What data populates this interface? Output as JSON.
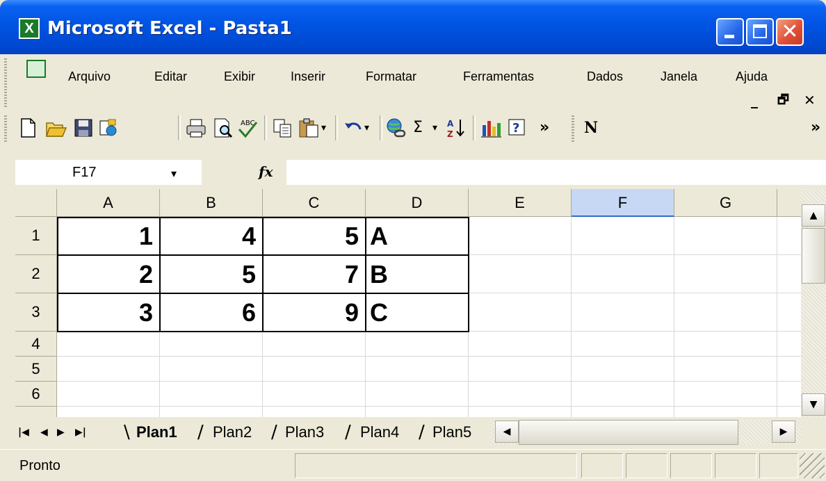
{
  "window": {
    "title": "Microsoft Excel - Pasta1",
    "app_icon_glyph": "X",
    "controls": {
      "minimize_icon": "minimize-icon",
      "maximize_icon": "maximize-icon",
      "close_glyph": "✕"
    }
  },
  "menubar": {
    "items": [
      "Arquivo",
      "Editar",
      "Exibir",
      "Inserir",
      "Formatar",
      "Ferramentas",
      "Dados",
      "Janela",
      "Ajuda"
    ],
    "doc_controls": {
      "minimize": "_",
      "restore": "🗗",
      "close": "✕"
    }
  },
  "toolbar": {
    "buttons": [
      "new-icon",
      "open-icon",
      "save-icon",
      "permissions-icon",
      "print-icon",
      "print-preview-icon",
      "spelling-icon",
      "copy-icon",
      "paste-icon",
      "undo-icon",
      "hyperlink-icon",
      "autosum-icon",
      "sort-ascending-icon",
      "chart-wizard-icon",
      "help-icon"
    ],
    "autosum_glyph": "Σ",
    "overflow_glyph": "»",
    "bold_label": "N",
    "dropdown_glyph": "▾"
  },
  "formula_bar": {
    "name_box": "F17",
    "fx_label": "fx",
    "formula": ""
  },
  "sheet": {
    "columns": [
      "A",
      "B",
      "C",
      "D",
      "E",
      "F",
      "G"
    ],
    "selected_column": "F",
    "rows": [
      "1",
      "2",
      "3",
      "4",
      "5",
      "6"
    ],
    "cells": {
      "A1": "1",
      "B1": "4",
      "C1": "5",
      "D1": "A",
      "A2": "2",
      "B2": "5",
      "C2": "7",
      "D2": "B",
      "A3": "3",
      "B3": "6",
      "C3": "9",
      "D3": "C"
    }
  },
  "tabs": {
    "nav": [
      "|◀",
      "◀",
      "▶",
      "▶|"
    ],
    "sheets": [
      "Plan1",
      "Plan2",
      "Plan3",
      "Plan4",
      "Plan5"
    ],
    "active": "Plan1"
  },
  "scroll": {
    "up": "▲",
    "down": "▼",
    "left": "◀",
    "right": "▶"
  },
  "status": {
    "text": "Pronto"
  }
}
